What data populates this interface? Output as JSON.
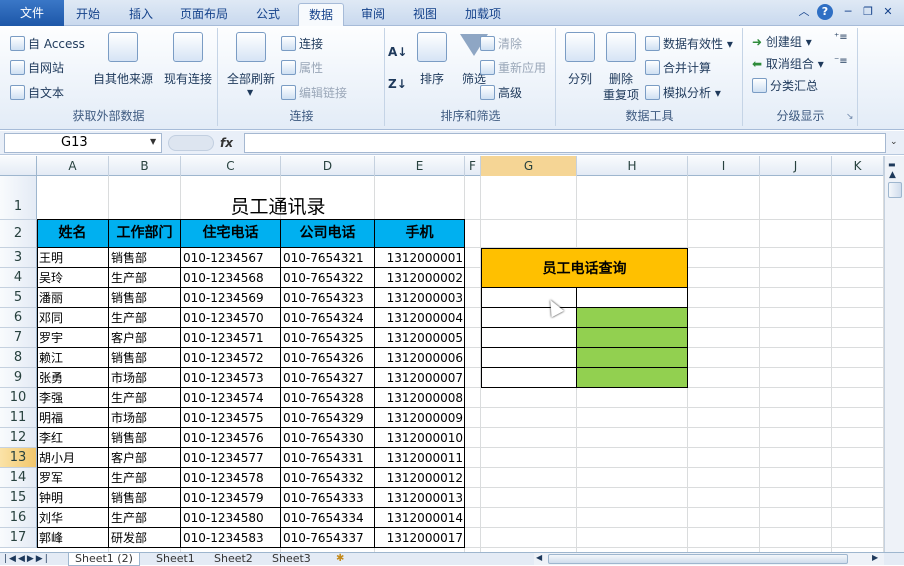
{
  "tabs": {
    "file": "文件",
    "items": [
      "开始",
      "插入",
      "页面布局",
      "公式",
      "数据",
      "审阅",
      "视图",
      "加载项"
    ]
  },
  "ribbon": {
    "ext": {
      "access": "自 Access",
      "web": "自网站",
      "text": "自文本",
      "other": "自其他来源",
      "existing": "现有连接",
      "label": "获取外部数据"
    },
    "conn": {
      "refresh": "全部刷新",
      "connections": "连接",
      "props": "属性",
      "links": "编辑链接",
      "label": "连接"
    },
    "sort": {
      "sort": "排序",
      "filter": "筛选",
      "clear": "清除",
      "reapply": "重新应用",
      "advanced": "高级",
      "label": "排序和筛选"
    },
    "tools": {
      "split": "分列",
      "remove": "删除",
      "remove2": "重复项",
      "validation": "数据有效性",
      "consolidate": "合并计算",
      "whatif": "模拟分析",
      "label": "数据工具"
    },
    "outline": {
      "group": "创建组",
      "ungroup": "取消组合",
      "subtotal": "分类汇总",
      "label": "分级显示"
    }
  },
  "formula_bar": {
    "name_box": "G13",
    "fx": "fx",
    "value": ""
  },
  "columns": [
    "A",
    "B",
    "C",
    "D",
    "E",
    "F",
    "G",
    "H",
    "I",
    "J",
    "K"
  ],
  "rows": [
    "1",
    "2",
    "3",
    "4",
    "5",
    "6",
    "7",
    "8",
    "9",
    "10",
    "11",
    "12",
    "13",
    "14",
    "15",
    "16",
    "17"
  ],
  "table": {
    "title": "员工通讯录",
    "headers": [
      "姓名",
      "工作部门",
      "住宅电话",
      "公司电话",
      "手机"
    ],
    "data": [
      [
        "王明",
        "销售部",
        "010-1234567",
        "010-7654321",
        "1312000001"
      ],
      [
        "吴玲",
        "生产部",
        "010-1234568",
        "010-7654322",
        "1312000002"
      ],
      [
        "潘丽",
        "销售部",
        "010-1234569",
        "010-7654323",
        "1312000003"
      ],
      [
        "邓同",
        "生产部",
        "010-1234570",
        "010-7654324",
        "1312000004"
      ],
      [
        "罗宇",
        "客户部",
        "010-1234571",
        "010-7654325",
        "1312000005"
      ],
      [
        "赖江",
        "销售部",
        "010-1234572",
        "010-7654326",
        "1312000006"
      ],
      [
        "张勇",
        "市场部",
        "010-1234573",
        "010-7654327",
        "1312000007"
      ],
      [
        "李强",
        "生产部",
        "010-1234574",
        "010-7654328",
        "1312000008"
      ],
      [
        "明福",
        "市场部",
        "010-1234575",
        "010-7654329",
        "1312000009"
      ],
      [
        "李红",
        "销售部",
        "010-1234576",
        "010-7654330",
        "1312000010"
      ],
      [
        "胡小月",
        "客户部",
        "010-1234577",
        "010-7654331",
        "1312000011"
      ],
      [
        "罗军",
        "生产部",
        "010-1234578",
        "010-7654332",
        "1312000012"
      ],
      [
        "钟明",
        "销售部",
        "010-1234579",
        "010-7654333",
        "1312000013"
      ],
      [
        "刘华",
        "生产部",
        "010-1234580",
        "010-7654334",
        "1312000014"
      ],
      [
        "郭峰",
        "研发部",
        "010-1234583",
        "010-7654337",
        "1312000017"
      ]
    ]
  },
  "lookup": {
    "title": "员工电话查询",
    "title_color": "#ffc000",
    "fill_color": "#92d050"
  },
  "sheets": [
    "Sheet1 (2)",
    "Sheet1",
    "Sheet2",
    "Sheet3"
  ],
  "colors": {
    "header": "#00b0f0"
  }
}
